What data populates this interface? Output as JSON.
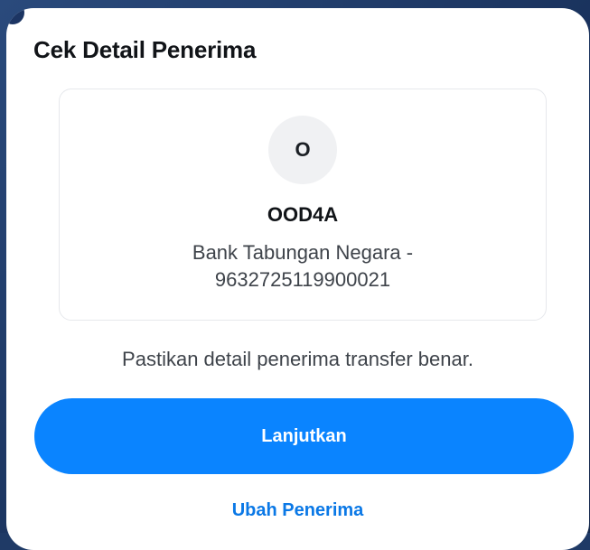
{
  "dialog": {
    "title": "Cek Detail Penerima"
  },
  "recipient": {
    "avatar_initial": "O",
    "name": "OOD4A",
    "bank_line": "Bank Tabungan Negara -",
    "account_number": "9632725119900021"
  },
  "note": "Pastikan detail penerima transfer benar.",
  "actions": {
    "continue_label": "Lanjutkan",
    "change_label": "Ubah Penerima"
  },
  "colors": {
    "primary": "#0a84ff",
    "link": "#0a78e6",
    "background": "#1f3a66"
  }
}
